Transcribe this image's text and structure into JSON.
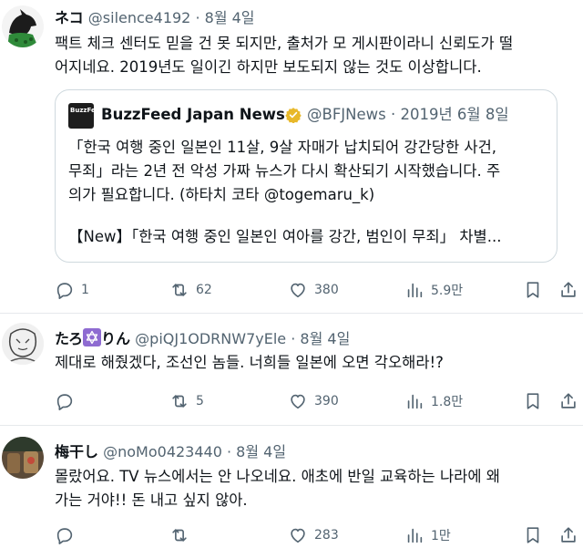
{
  "tweets": [
    {
      "name": "ネコ",
      "handle": "@silence4192",
      "dot": "·",
      "date": "8월 4일",
      "text_line1": "팩트 체크 센터도 믿을 건 못 되지만, 출처가 모 게시판이라니 신뢰도가 떨",
      "text_line2": "어지네요. 2019년도 일이긴 하지만 보도되지 않는 것도 이상합니다.",
      "replies": "1",
      "retweets": "62",
      "likes": "380",
      "views": "5.9만",
      "quote": {
        "logo_text": "BuzzFeed News",
        "name": "BuzzFeed Japan News",
        "handle": "@BFJNews",
        "dot": "·",
        "date": "2019년 6월 8일",
        "line1": "「한국 여행 중인 일본인 11살, 9살 자매가 납치되어 강간당한 사건,",
        "line2": "무죄」라는 2년 전 악성 가짜 뉴스가 다시 확산되기 시작했습니다. 주",
        "line3": "의가 필요합니다. (하타치 코타 @togemaru_k)",
        "line4": "【New】「한국 여행 중인 일본인 여아를 강간, 범인이 무죄」 차별..."
      }
    },
    {
      "name_part1": "たろ",
      "name_part2": "りん",
      "handle": "@piQJ1ODRNW7yEle",
      "dot": "·",
      "date": "8월 4일",
      "text_line1": "제대로 해줬겠다, 조선인 놈들. 너희들 일본에 오면 각오해라!?",
      "replies": "",
      "retweets": "5",
      "likes": "390",
      "views": "1.8만"
    },
    {
      "name": "梅干し",
      "handle": "@noMo0423440",
      "dot": "·",
      "date": "8월 4일",
      "text_line1": "몰랐어요. TV 뉴스에서는 안 나오네요. 애초에 반일 교육하는 나라에 왜",
      "text_line2": "가는 거야!! 돈 내고 싶지 않아.",
      "replies": "",
      "retweets": "",
      "likes": "283",
      "views": "1만"
    }
  ],
  "colors": {
    "text": "#0f1419",
    "muted": "#536471",
    "border": "#cfd9de",
    "verified_gold": "#e8b829",
    "star_bg": "#8e6bd1"
  }
}
